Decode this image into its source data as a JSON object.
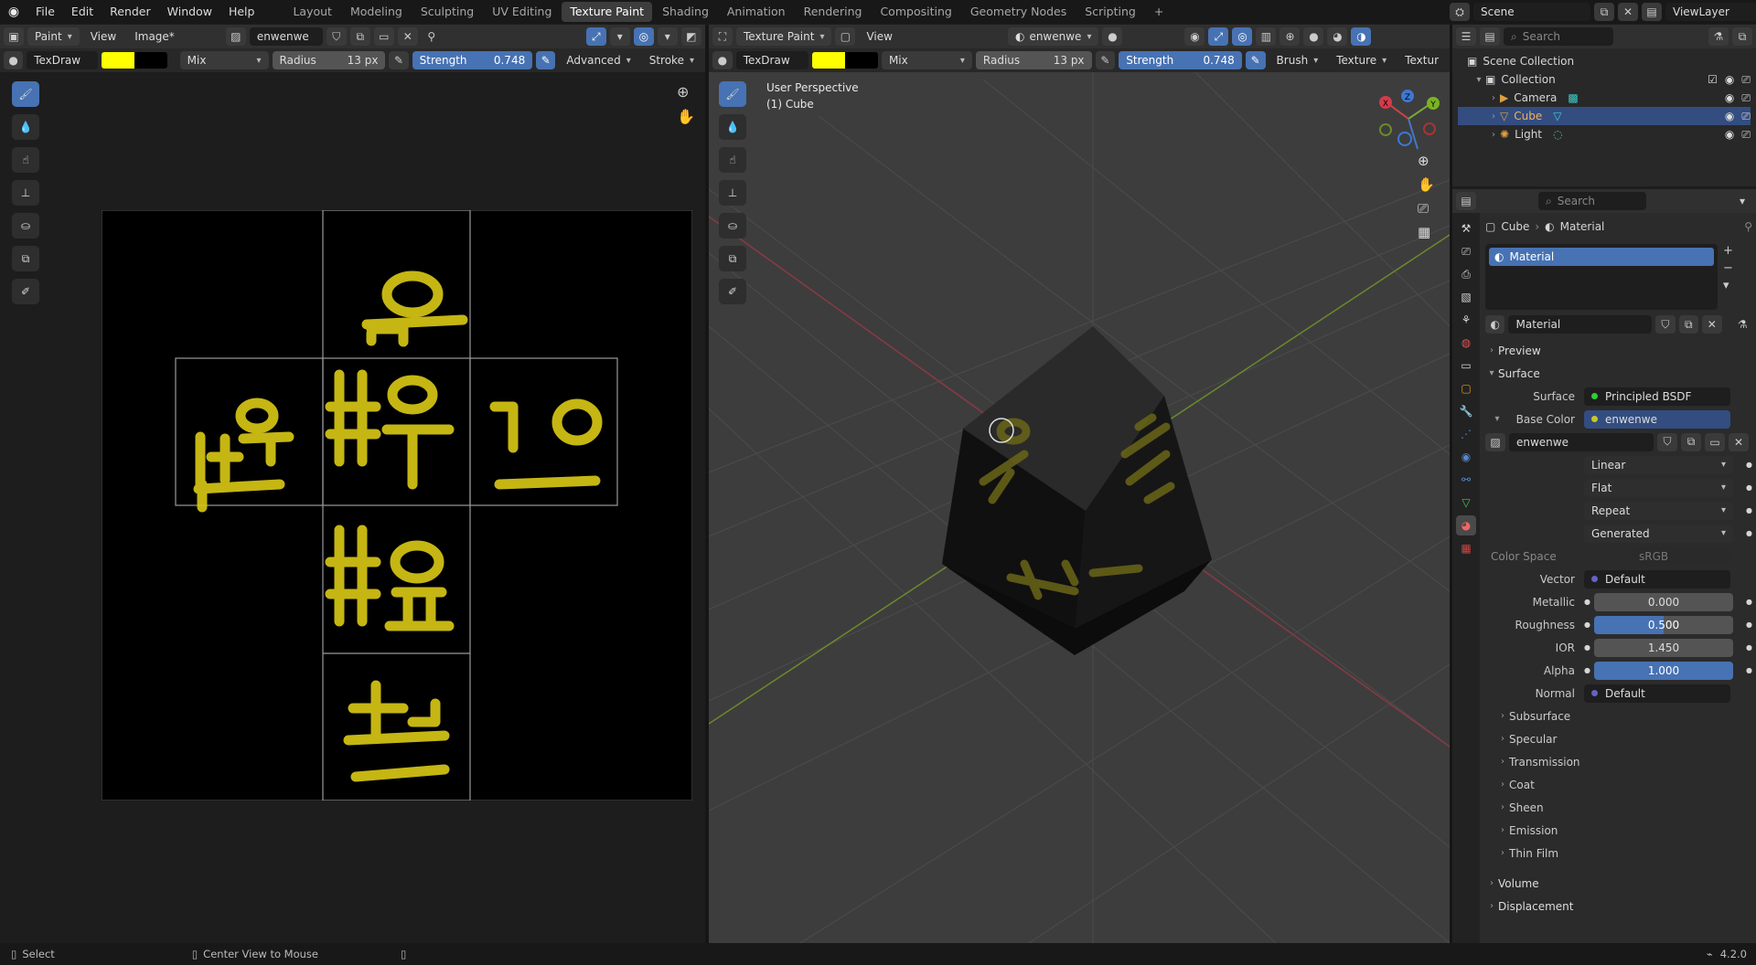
{
  "menu": {
    "file": "File",
    "edit": "Edit",
    "render": "Render",
    "window": "Window",
    "help": "Help"
  },
  "workspaces": [
    "Layout",
    "Modeling",
    "Sculpting",
    "UV Editing",
    "Texture Paint",
    "Shading",
    "Animation",
    "Rendering",
    "Compositing",
    "Geometry Nodes",
    "Scripting"
  ],
  "active_workspace": "Texture Paint",
  "scene": {
    "name": "Scene",
    "view_layer": "ViewLayer"
  },
  "image_editor": {
    "mode": "Paint",
    "view": "View",
    "image_menu": "Image*",
    "image_name": "enwenwe",
    "tool": {
      "brush": "TexDraw",
      "color": "#ffff00",
      "secondary": "#000000",
      "blend": "Mix",
      "radius_label": "Radius",
      "radius": "13 px",
      "strength_label": "Strength",
      "strength": "0.748",
      "advanced": "Advanced",
      "stroke": "Stroke"
    }
  },
  "viewport": {
    "mode": "Texture Paint",
    "view": "View",
    "image_name": "enwenwe",
    "info_line1": "User Perspective",
    "info_line2": "(1) Cube",
    "tool": {
      "brush": "TexDraw",
      "color": "#ffff00",
      "secondary": "#000000",
      "blend": "Mix",
      "radius_label": "Radius",
      "radius": "13 px",
      "strength_label": "Strength",
      "strength": "0.748",
      "brush_menu": "Brush",
      "texture_menu": "Texture",
      "texture_menu2": "Textur"
    },
    "gizmo": {
      "x": "X",
      "y": "Y",
      "z": "Z"
    }
  },
  "outliner": {
    "search_placeholder": "Search",
    "scene_collection": "Scene Collection",
    "collection": "Collection",
    "items": [
      {
        "name": "Camera"
      },
      {
        "name": "Cube"
      },
      {
        "name": "Light"
      }
    ]
  },
  "properties": {
    "search_placeholder": "Search",
    "breadcrumb_object": "Cube",
    "breadcrumb_material": "Material",
    "slot": "Material",
    "material_name": "Material",
    "panels": {
      "preview": "Preview",
      "surface": "Surface"
    },
    "surface": {
      "label": "Surface",
      "value": "Principled BSDF"
    },
    "base_color": {
      "label": "Base Color",
      "value": "enwenwe"
    },
    "image_name": "enwenwe",
    "interpolation": "Linear",
    "projection": "Flat",
    "extension": "Repeat",
    "source": "Generated",
    "color_space": {
      "label": "Color Space",
      "value": "sRGB"
    },
    "vector": {
      "label": "Vector",
      "value": "Default"
    },
    "metallic": {
      "label": "Metallic",
      "value": "0.000"
    },
    "roughness": {
      "label": "Roughness",
      "value": "0.500"
    },
    "ior": {
      "label": "IOR",
      "value": "1.450"
    },
    "alpha": {
      "label": "Alpha",
      "value": "1.000"
    },
    "normal": {
      "label": "Normal",
      "value": "Default"
    },
    "subpanels": [
      "Subsurface",
      "Specular",
      "Transmission",
      "Coat",
      "Sheen",
      "Emission",
      "Thin Film"
    ],
    "volume": "Volume",
    "displacement": "Displacement"
  },
  "statusbar": {
    "select": "Select",
    "center_view": "Center View to Mouse",
    "version": "4.2.0"
  }
}
